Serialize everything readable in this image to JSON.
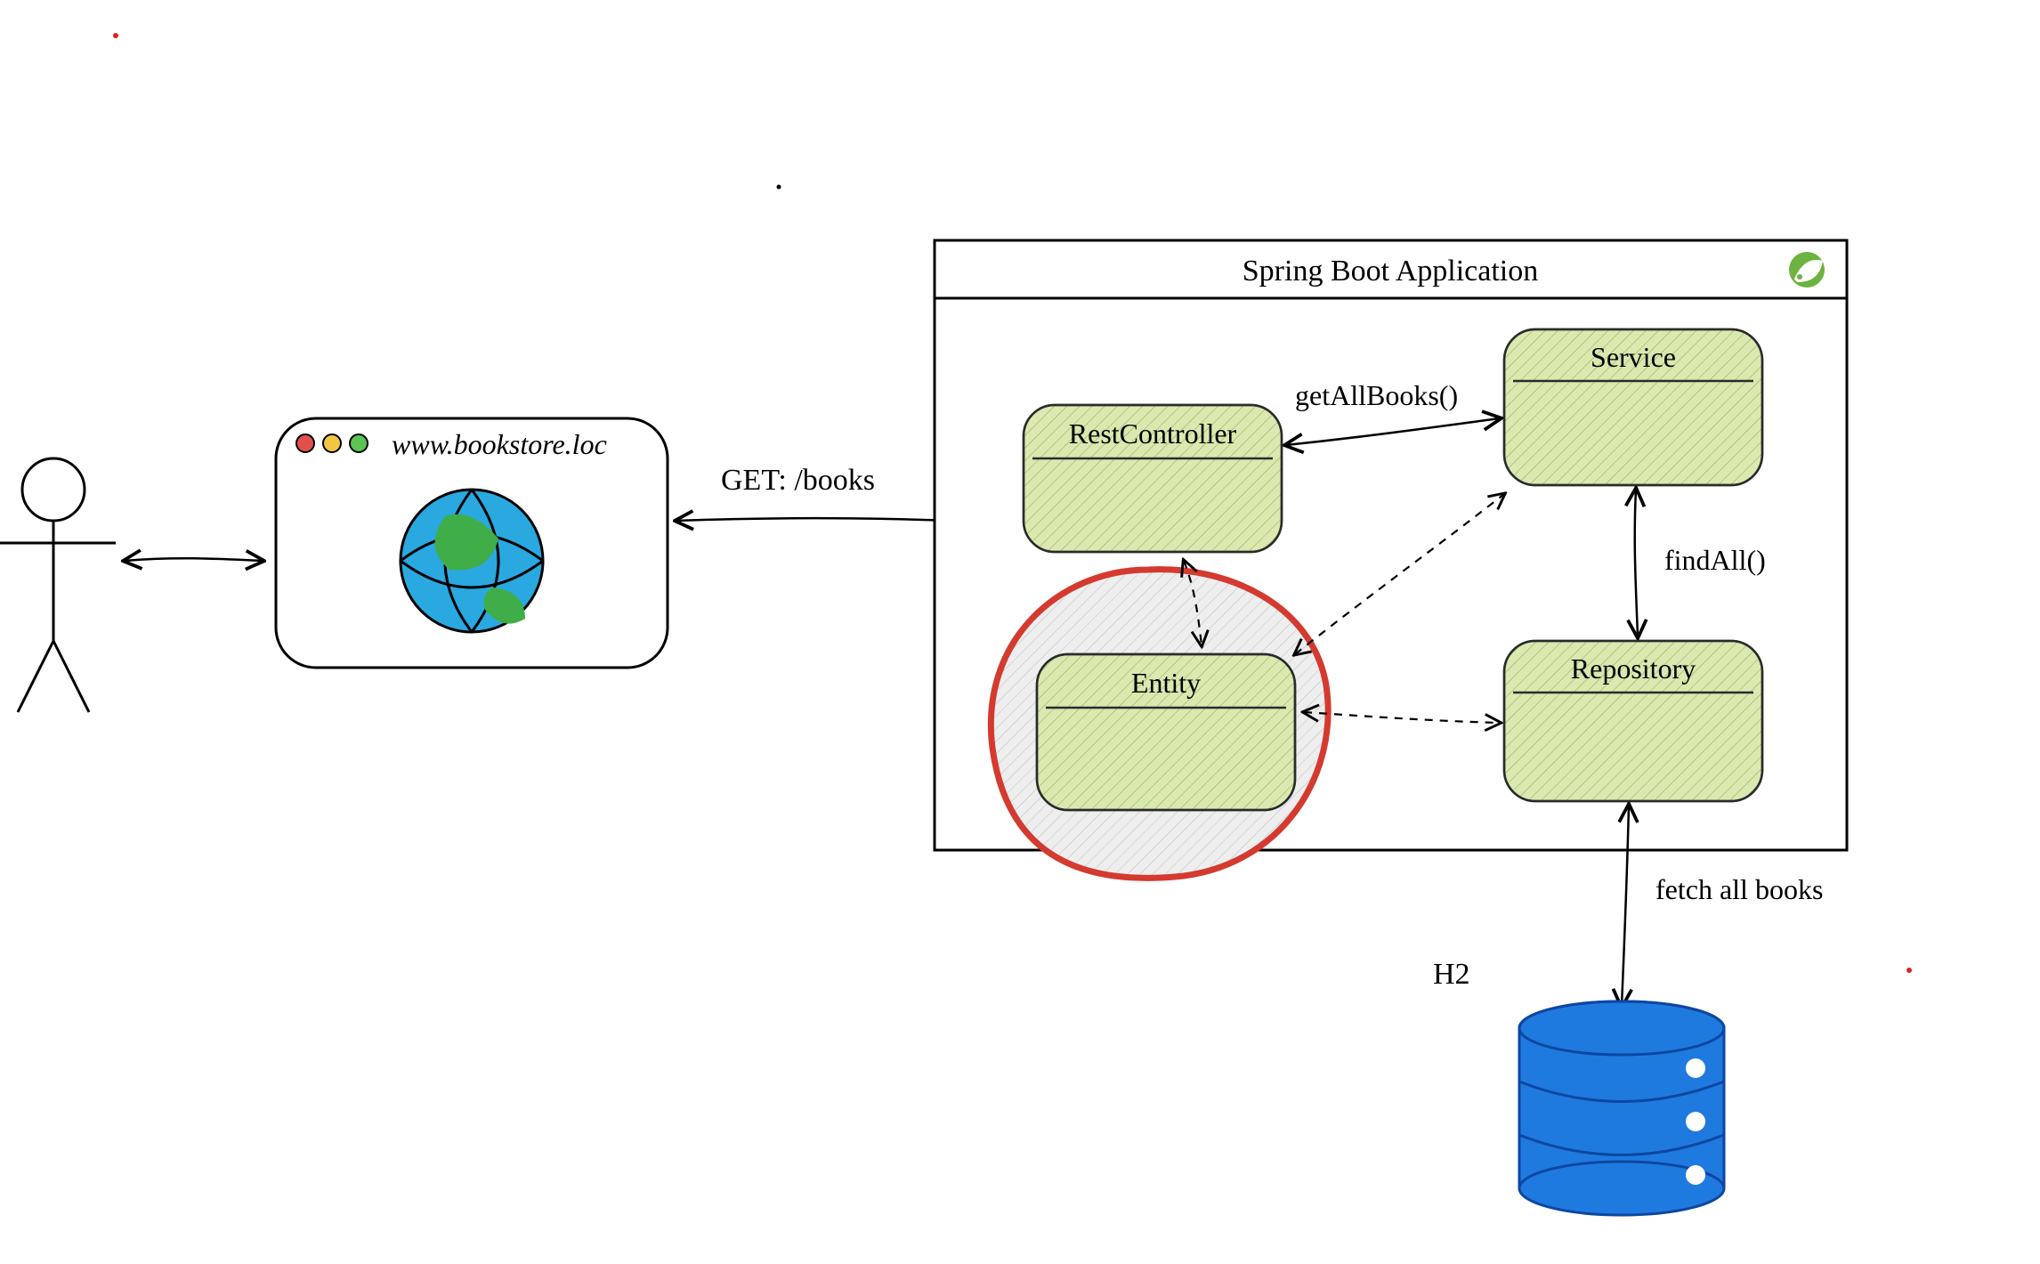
{
  "app_container": {
    "title": "Spring Boot Application"
  },
  "browser": {
    "url": "www.bookstore.loc"
  },
  "components": {
    "controller": "RestController",
    "service": "Service",
    "repository": "Repository",
    "entity": "Entity"
  },
  "arrows": {
    "http": "GET: /books",
    "service_call": "getAllBooks()",
    "repo_call": "findAll()",
    "db_call": "fetch all books"
  },
  "db": {
    "name": "H2"
  }
}
